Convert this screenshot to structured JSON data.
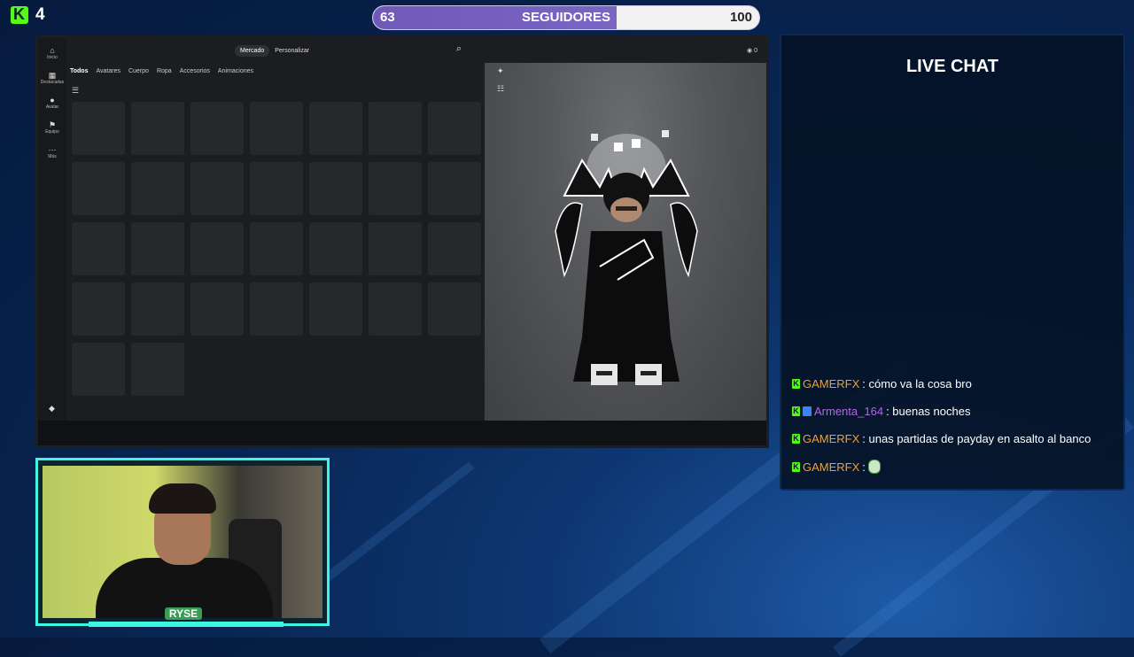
{
  "overlay": {
    "viewer_count": "4",
    "goal": {
      "current": "63",
      "label": "SEGUIDORES",
      "target": "100",
      "progress_fraction": 0.63
    }
  },
  "game": {
    "rail": [
      {
        "label": "Inicio",
        "icon": "home-icon"
      },
      {
        "label": "Destacadas",
        "icon": "featured-icon"
      },
      {
        "label": "Avatar",
        "icon": "avatar-icon"
      },
      {
        "label": "Equipo",
        "icon": "team-icon"
      },
      {
        "label": "Más",
        "icon": "more-icon"
      }
    ],
    "segments": [
      "Mercado",
      "Personalizar"
    ],
    "tabs": [
      "Todos",
      "Avatares",
      "Cuerpo",
      "Ropa",
      "Accesorios",
      "Animaciones"
    ],
    "coin_text": "0"
  },
  "chat": {
    "title": "LIVE CHAT",
    "messages": [
      {
        "user": "GAMERFX",
        "color": "#f0a030",
        "text": ": cómo va la cosa bro",
        "badge2": false,
        "emote": false
      },
      {
        "user": "Armenta_164",
        "color": "#b069e0",
        "text": ": buenas noches",
        "badge2": true,
        "emote": false
      },
      {
        "user": "GAMERFX",
        "color": "#f0a030",
        "text": ": unas partidas de payday en asalto al banco",
        "badge2": false,
        "emote": false
      },
      {
        "user": "GAMERFX",
        "color": "#f0a030",
        "text": ":",
        "badge2": false,
        "emote": true
      }
    ]
  },
  "webcam": {
    "overlay_label": "RYSE"
  }
}
